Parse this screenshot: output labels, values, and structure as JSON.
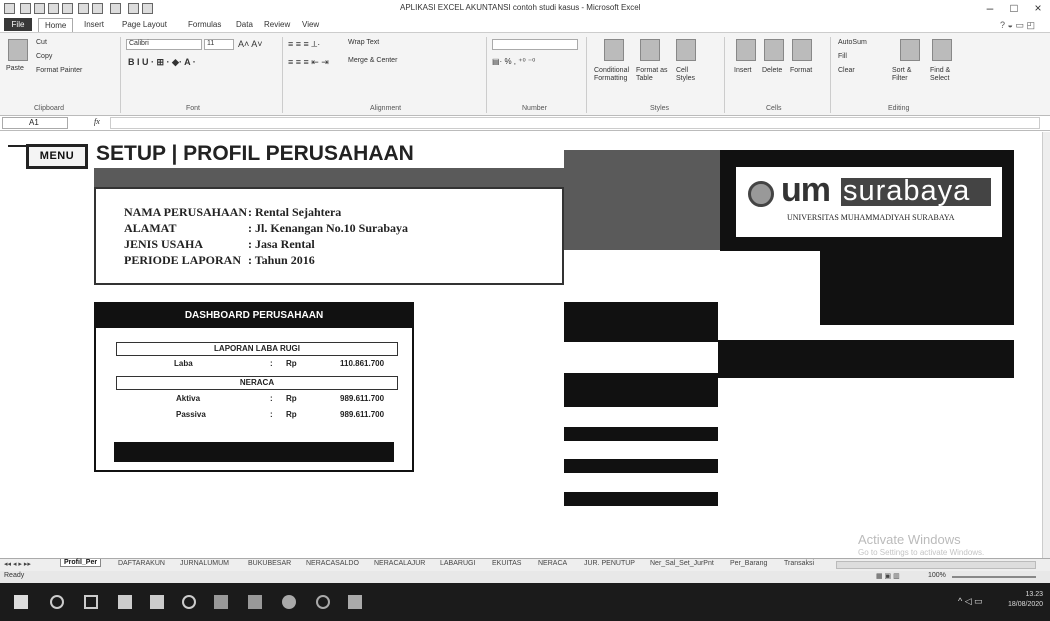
{
  "window": {
    "title": "APLIKASI EXCEL AKUNTANSI contoh studi kasus - Microsoft Excel",
    "controls": {
      "minimize": "–",
      "maximize": "□",
      "close": "×"
    }
  },
  "ribbon_tabs": [
    "File",
    "Home",
    "Insert",
    "Page Layout",
    "Formulas",
    "Data",
    "Review",
    "View"
  ],
  "ribbon": {
    "clipboard": {
      "paste": "Paste",
      "cut": "Cut",
      "copy": "Copy",
      "format_painter": "Format Painter",
      "label": "Clipboard"
    },
    "font": {
      "name": "Calibri",
      "size": "11",
      "label": "Font"
    },
    "alignment": {
      "wrap": "Wrap Text",
      "merge": "Merge & Center",
      "label": "Alignment"
    },
    "number": {
      "label": "Number"
    },
    "styles": {
      "conditional": "Conditional Formatting",
      "format_table": "Format as Table",
      "cell_styles": "Cell Styles",
      "label": "Styles"
    },
    "cells": {
      "insert": "Insert",
      "delete": "Delete",
      "format": "Format",
      "label": "Cells"
    },
    "editing": {
      "autosum": "AutoSum",
      "fill": "Fill",
      "clear": "Clear",
      "sort": "Sort & Filter",
      "find": "Find & Select",
      "label": "Editing"
    }
  },
  "formula_bar": {
    "cell": "A1",
    "fx": "fx"
  },
  "sheet": {
    "menu_button": "MENU",
    "title": "SETUP | PROFIL PERUSAHAAN",
    "profile": [
      {
        "label": "NAMA PERUSAHAAN",
        "value": ": Rental Sejahtera"
      },
      {
        "label": "ALAMAT",
        "value": ": Jl. Kenangan No.10 Surabaya"
      },
      {
        "label": "JENIS USAHA",
        "value": ": Jasa Rental"
      },
      {
        "label": "PERIODE LAPORAN",
        "value": ": Tahun 2016"
      }
    ],
    "logo": {
      "um": "um",
      "surabaya": "surabaya",
      "subtitle": "UNIVERSITAS MUHAMMADIYAH SURABAYA"
    },
    "dashboard": {
      "title": "DASHBOARD PERUSAHAAN",
      "laba_rugi_title": "LAPORAN LABA RUGI",
      "laba": {
        "label": "Laba",
        "sep": ":",
        "cur": "Rp",
        "value": "110.861.700"
      },
      "neraca_title": "NERACA",
      "aktiva": {
        "label": "Aktiva",
        "sep": ":",
        "cur": "Rp",
        "value": "989.611.700"
      },
      "passiva": {
        "label": "Passiva",
        "sep": ":",
        "cur": "Rp",
        "value": "989.611.700"
      }
    }
  },
  "watermark": {
    "line1": "Activate Windows",
    "line2": "Go to Settings to activate Windows."
  },
  "sheet_tabs": [
    "Profil_Per",
    "DAFTARAKUN",
    "JURNALUMUM",
    "BUKUBESAR",
    "NERACASALDO",
    "NERACALAJUR",
    "LABARUGI",
    "EKUITAS",
    "NERACA",
    "JUR. PENUTUP",
    "Ner_Sal_Set_JurPnt",
    "Per_Barang",
    "Transaksi"
  ],
  "status": {
    "ready": "Ready",
    "zoom": "100%"
  },
  "taskbar": {
    "time": "13.23",
    "date": "18/08/2020"
  }
}
